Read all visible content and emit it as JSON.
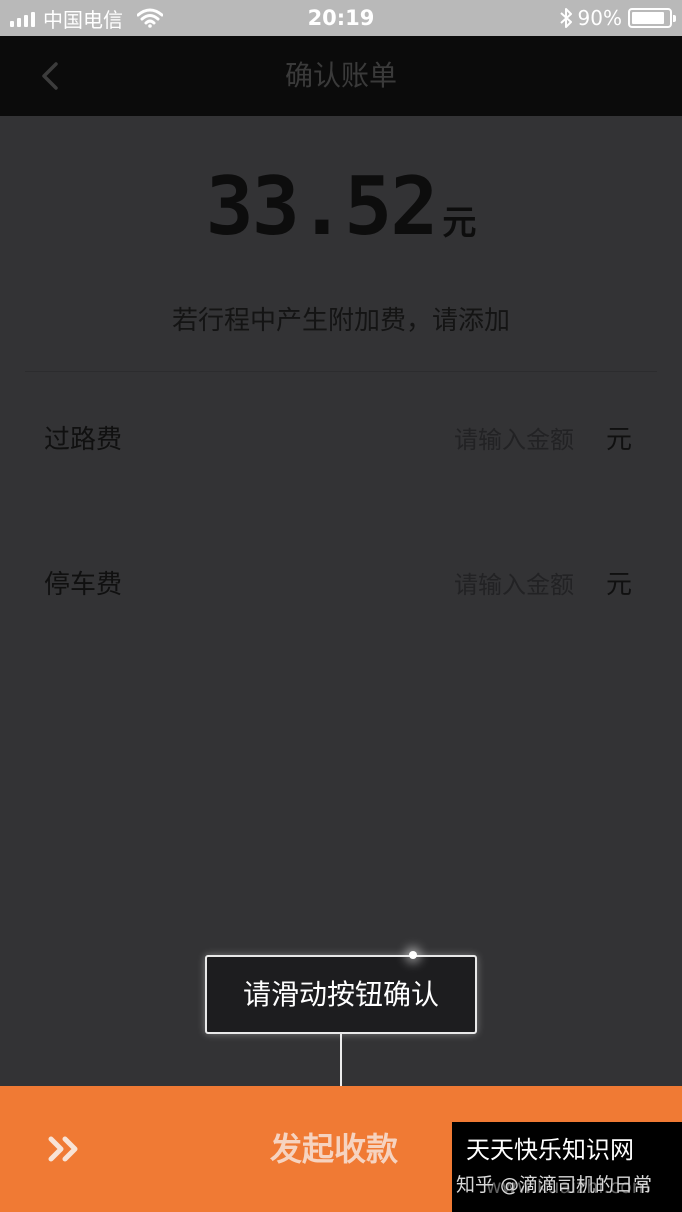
{
  "status_bar": {
    "carrier": "中国电信",
    "time": "20:19",
    "battery": "90%",
    "battery_level": 0.9
  },
  "header": {
    "title": "确认账单",
    "back_icon": "chevron-left-icon"
  },
  "bill": {
    "amount": "33.52",
    "unit": "元",
    "hint": "若行程中产生附加费，请添加"
  },
  "fees": [
    {
      "label": "过路费",
      "placeholder": "请输入金额",
      "unit": "元"
    },
    {
      "label": "停车费",
      "placeholder": "请输入金额",
      "unit": "元"
    }
  ],
  "tooltip": {
    "text": "请滑动按钮确认"
  },
  "slider": {
    "label": "发起收款",
    "handle_icon": "double-chevron-right-icon",
    "color": "#f07a34"
  },
  "watermark": {
    "title": "天天快乐知识网",
    "subtitle": "知乎 @滴滴司机的日常",
    "site": "www.kuaizhi.com"
  }
}
